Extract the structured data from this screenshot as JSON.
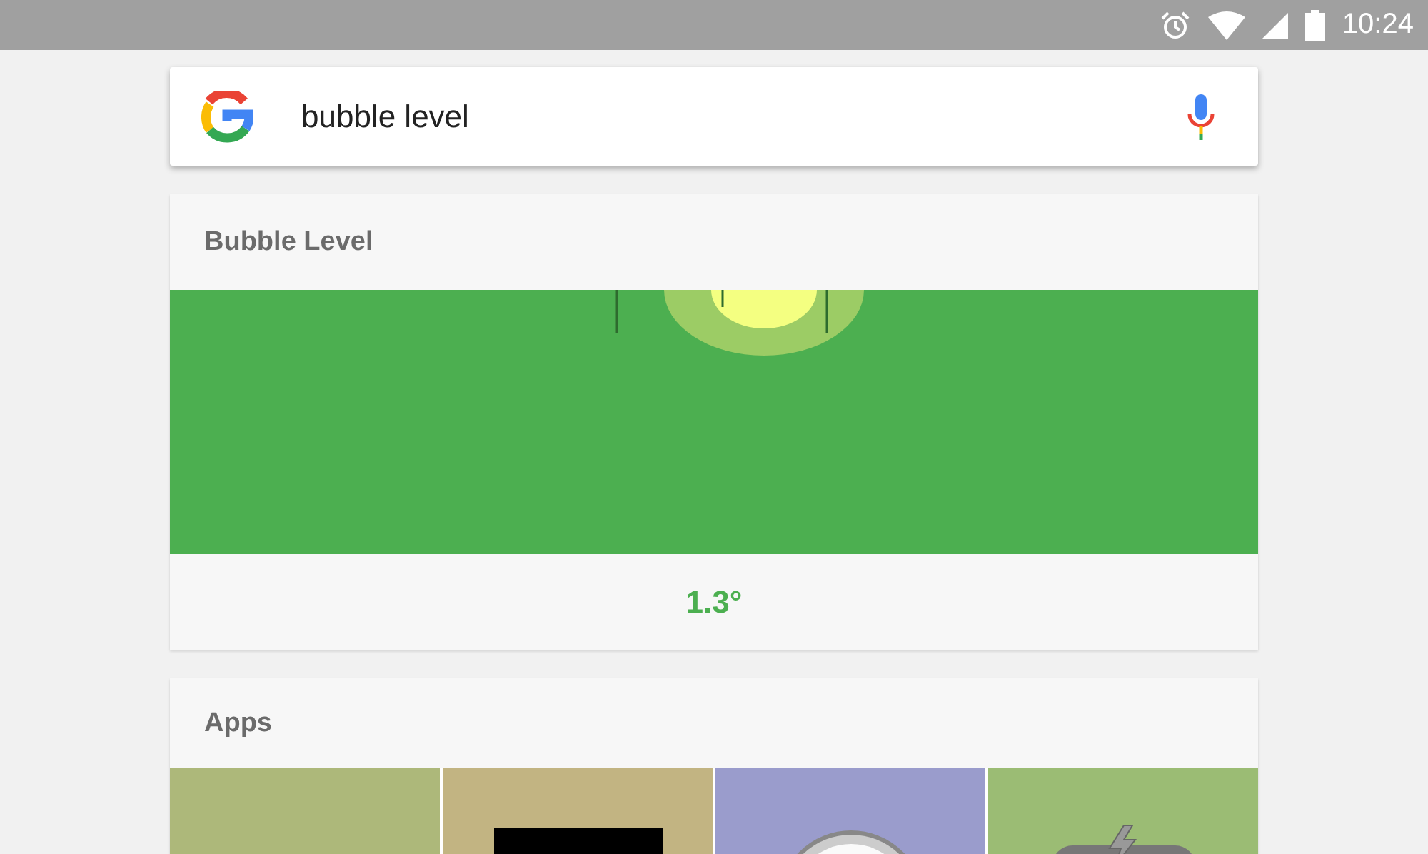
{
  "status_bar": {
    "time": "10:24"
  },
  "search": {
    "query": "bubble level"
  },
  "level_card": {
    "title": "Bubble Level",
    "reading": "1.3°"
  },
  "apps_card": {
    "title": "Apps",
    "tiles": [
      {
        "color": "#adb87a",
        "kind": "plain"
      },
      {
        "color": "#c2b482",
        "kind": "screen"
      },
      {
        "color": "#9a9ccc",
        "kind": "gauge"
      },
      {
        "color": "#9bbc74",
        "kind": "battery"
      }
    ]
  }
}
